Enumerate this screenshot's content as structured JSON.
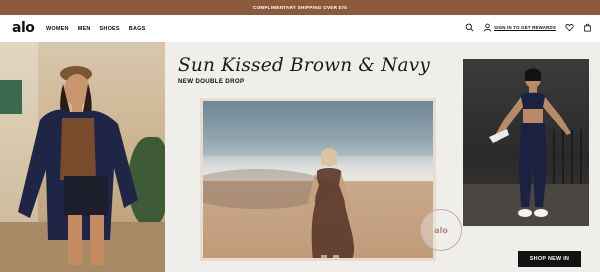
{
  "promo": {
    "text": "COMPLIMENTARY SHIPPING OVER $75"
  },
  "header": {
    "logo": "alo",
    "nav": [
      "WOMEN",
      "MEN",
      "SHOES",
      "BAGS"
    ],
    "signin_label": "SIGN IN TO GET REWARDS",
    "icons": [
      "search-icon",
      "user-icon",
      "heart-icon",
      "bag-icon"
    ]
  },
  "hero": {
    "headline": "Sun Kissed Brown & Navy",
    "subhead": "NEW DOUBLE DROP",
    "stamp_text": "alo",
    "cta_label": "SHOP NEW IN"
  },
  "colors": {
    "promo_bg": "#8a5a3b",
    "hero_bg": "#f0eeeb",
    "cta_bg": "#111111",
    "stamp": "#c9a6a4"
  }
}
